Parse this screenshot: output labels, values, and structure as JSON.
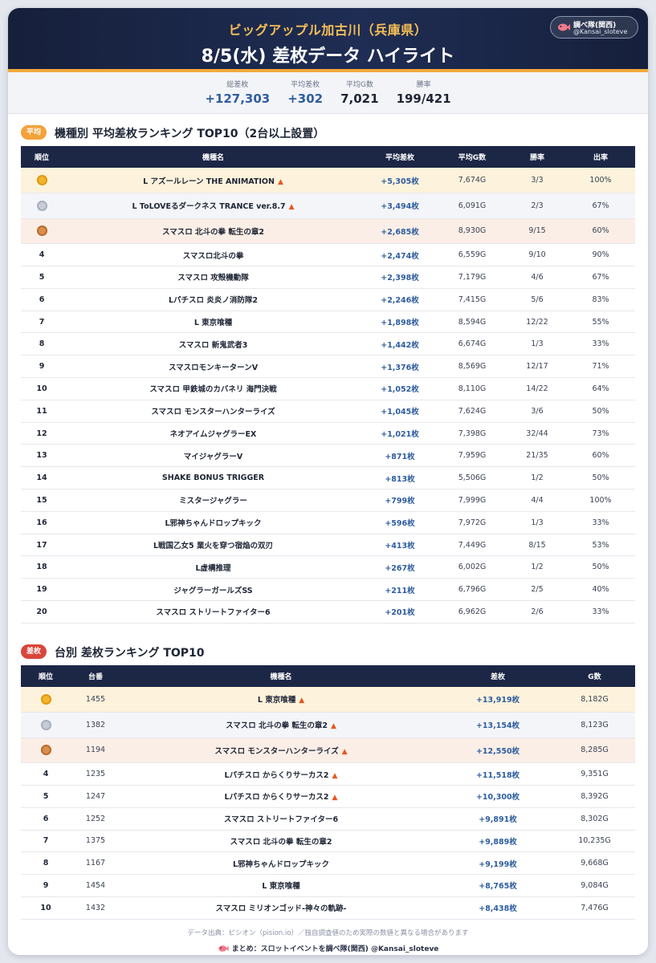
{
  "header": {
    "store": "ビッグアップル加古川（兵庫県）",
    "title": "8/5(水) 差枚データ ハイライト",
    "badge_name": "調べ隊(関西)",
    "badge_handle": "@Kansai_sloteve"
  },
  "summary": [
    {
      "label": "総差枚",
      "value": "+127,303",
      "accent": true
    },
    {
      "label": "平均差枚",
      "value": "+302",
      "accent": true
    },
    {
      "label": "平均G数",
      "value": "7,021",
      "accent": false
    },
    {
      "label": "勝率",
      "value": "199/421",
      "accent": false
    }
  ],
  "section1": {
    "pill": "平均",
    "title": "機種別 平均差枚ランキング TOP10（2台以上設置）",
    "headers": [
      "順位",
      "機種名",
      "平均差枚",
      "平均G数",
      "勝率",
      "出率"
    ],
    "rows": [
      {
        "rank": "1",
        "medal": "gold",
        "name": "L アズールレーン THE ANIMATION",
        "fire": true,
        "diff": "+5,305枚",
        "games": "7,674G",
        "win": "3/3",
        "rate": "100%"
      },
      {
        "rank": "2",
        "medal": "silver",
        "name": "L ToLOVEるダークネス TRANCE ver.8.7",
        "fire": true,
        "diff": "+3,494枚",
        "games": "6,091G",
        "win": "2/3",
        "rate": "67%"
      },
      {
        "rank": "3",
        "medal": "bronze",
        "name": "スマスロ 北斗の拳 転生の章2",
        "fire": false,
        "diff": "+2,685枚",
        "games": "8,930G",
        "win": "9/15",
        "rate": "60%"
      },
      {
        "rank": "4",
        "medal": "",
        "name": "スマスロ北斗の拳",
        "fire": false,
        "diff": "+2,474枚",
        "games": "6,559G",
        "win": "9/10",
        "rate": "90%"
      },
      {
        "rank": "5",
        "medal": "",
        "name": "スマスロ 攻殻機動隊",
        "fire": false,
        "diff": "+2,398枚",
        "games": "7,179G",
        "win": "4/6",
        "rate": "67%"
      },
      {
        "rank": "6",
        "medal": "",
        "name": "Lパチスロ 炎炎ノ消防隊2",
        "fire": false,
        "diff": "+2,246枚",
        "games": "7,415G",
        "win": "5/6",
        "rate": "83%"
      },
      {
        "rank": "7",
        "medal": "",
        "name": "L 東京喰種",
        "fire": false,
        "diff": "+1,898枚",
        "games": "8,594G",
        "win": "12/22",
        "rate": "55%"
      },
      {
        "rank": "8",
        "medal": "",
        "name": "スマスロ 新鬼武者3",
        "fire": false,
        "diff": "+1,442枚",
        "games": "6,674G",
        "win": "1/3",
        "rate": "33%"
      },
      {
        "rank": "9",
        "medal": "",
        "name": "スマスロモンキーターンV",
        "fire": false,
        "diff": "+1,376枚",
        "games": "8,569G",
        "win": "12/17",
        "rate": "71%"
      },
      {
        "rank": "10",
        "medal": "",
        "name": "スマスロ 甲鉄城のカバネリ 海門決戦",
        "fire": false,
        "diff": "+1,052枚",
        "games": "8,110G",
        "win": "14/22",
        "rate": "64%"
      },
      {
        "rank": "11",
        "medal": "",
        "name": "スマスロ モンスターハンターライズ",
        "fire": false,
        "diff": "+1,045枚",
        "games": "7,624G",
        "win": "3/6",
        "rate": "50%"
      },
      {
        "rank": "12",
        "medal": "",
        "name": "ネオアイムジャグラーEX",
        "fire": false,
        "diff": "+1,021枚",
        "games": "7,398G",
        "win": "32/44",
        "rate": "73%"
      },
      {
        "rank": "13",
        "medal": "",
        "name": "マイジャグラーV",
        "fire": false,
        "diff": "+871枚",
        "games": "7,959G",
        "win": "21/35",
        "rate": "60%"
      },
      {
        "rank": "14",
        "medal": "",
        "name": "SHAKE BONUS TRIGGER",
        "fire": false,
        "diff": "+813枚",
        "games": "5,506G",
        "win": "1/2",
        "rate": "50%"
      },
      {
        "rank": "15",
        "medal": "",
        "name": "ミスタージャグラー",
        "fire": false,
        "diff": "+799枚",
        "games": "7,999G",
        "win": "4/4",
        "rate": "100%"
      },
      {
        "rank": "16",
        "medal": "",
        "name": "L邪神ちゃんドロップキック",
        "fire": false,
        "diff": "+596枚",
        "games": "7,972G",
        "win": "1/3",
        "rate": "33%"
      },
      {
        "rank": "17",
        "medal": "",
        "name": "L戦国乙女5 業火を穿つ宿焔の双刃",
        "fire": false,
        "diff": "+413枚",
        "games": "7,449G",
        "win": "8/15",
        "rate": "53%"
      },
      {
        "rank": "18",
        "medal": "",
        "name": "L虚構推理",
        "fire": false,
        "diff": "+267枚",
        "games": "6,002G",
        "win": "1/2",
        "rate": "50%"
      },
      {
        "rank": "19",
        "medal": "",
        "name": "ジャグラーガールズSS",
        "fire": false,
        "diff": "+211枚",
        "games": "6,796G",
        "win": "2/5",
        "rate": "40%"
      },
      {
        "rank": "20",
        "medal": "",
        "name": "スマスロ ストリートファイター6",
        "fire": false,
        "diff": "+201枚",
        "games": "6,962G",
        "win": "2/6",
        "rate": "33%"
      }
    ]
  },
  "section2": {
    "pill": "差枚",
    "title": "台別 差枚ランキング TOP10",
    "headers": [
      "順位",
      "台番",
      "機種名",
      "差枚",
      "G数"
    ],
    "rows": [
      {
        "rank": "1",
        "medal": "gold",
        "unit": "1455",
        "name": "L 東京喰種",
        "fire": true,
        "diff": "+13,919枚",
        "games": "8,182G"
      },
      {
        "rank": "2",
        "medal": "silver",
        "unit": "1382",
        "name": "スマスロ 北斗の拳 転生の章2",
        "fire": true,
        "diff": "+13,154枚",
        "games": "8,123G"
      },
      {
        "rank": "3",
        "medal": "bronze",
        "unit": "1194",
        "name": "スマスロ モンスターハンターライズ",
        "fire": true,
        "diff": "+12,550枚",
        "games": "8,285G"
      },
      {
        "rank": "4",
        "medal": "",
        "unit": "1235",
        "name": "Lパチスロ からくりサーカス2",
        "fire": true,
        "diff": "+11,518枚",
        "games": "9,351G"
      },
      {
        "rank": "5",
        "medal": "",
        "unit": "1247",
        "name": "Lパチスロ からくりサーカス2",
        "fire": true,
        "diff": "+10,300枚",
        "games": "8,392G"
      },
      {
        "rank": "6",
        "medal": "",
        "unit": "1252",
        "name": "スマスロ ストリートファイター6",
        "fire": false,
        "diff": "+9,891枚",
        "games": "8,302G"
      },
      {
        "rank": "7",
        "medal": "",
        "unit": "1375",
        "name": "スマスロ 北斗の拳 転生の章2",
        "fire": false,
        "diff": "+9,889枚",
        "games": "10,235G"
      },
      {
        "rank": "8",
        "medal": "",
        "unit": "1167",
        "name": "L邪神ちゃんドロップキック",
        "fire": false,
        "diff": "+9,199枚",
        "games": "9,668G"
      },
      {
        "rank": "9",
        "medal": "",
        "unit": "1454",
        "name": "L 東京喰種",
        "fire": false,
        "diff": "+8,765枚",
        "games": "9,084G"
      },
      {
        "rank": "10",
        "medal": "",
        "unit": "1432",
        "name": "スマスロ ミリオンゴッド-神々の軌跡-",
        "fire": false,
        "diff": "+8,438枚",
        "games": "7,476G"
      }
    ]
  },
  "footer": {
    "source": "データ出典：ピシオン（pision.io）／独自調査値のため実際の数値と異なる場合があります",
    "credit": "まとめ：スロットイベントを調べ隊(関西) @Kansai_sloteve"
  },
  "icons": {
    "fire": "fire-icon",
    "fish": "fish-icon",
    "medal": "medal-icon"
  },
  "colors": {
    "navy": "#1c2746",
    "gold": "#f6bf55",
    "accent_blue": "#2e5d9e",
    "orange_pill": "#f3a23a",
    "red_pill": "#d8463a"
  }
}
